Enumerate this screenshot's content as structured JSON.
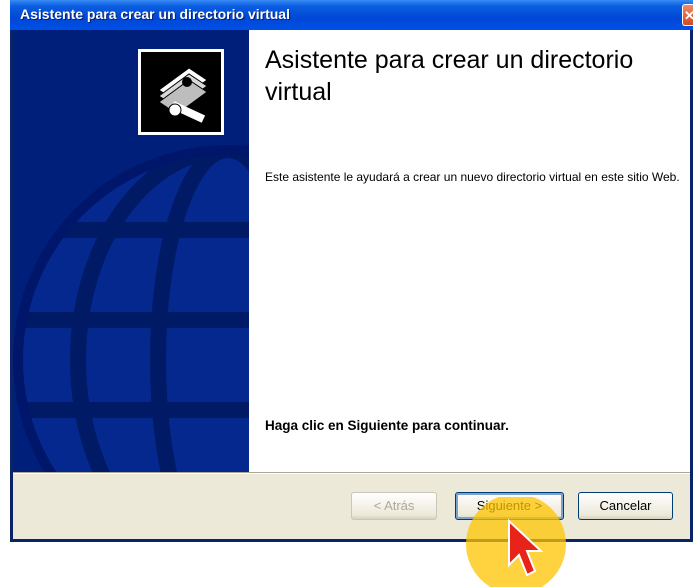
{
  "window": {
    "title": "Asistente para crear un directorio virtual",
    "close_glyph": "✕"
  },
  "banner": {
    "background_color": "#001f7a",
    "icon": "wizard-book-icon"
  },
  "content": {
    "heading": "Asistente para crear un directorio virtual",
    "description": "Este asistente le ayudará a crear un nuevo directorio virtual en este sitio Web.",
    "continue_hint": "Haga clic en Siguiente para continuar."
  },
  "buttons": {
    "back_label": "< Atrás",
    "next_label": "Siguiente >",
    "cancel_label": "Cancelar"
  },
  "colors": {
    "titlebar": "#0050e6",
    "cursor_highlight": "#ffc400",
    "cursor_arrow": "#e8231a"
  }
}
